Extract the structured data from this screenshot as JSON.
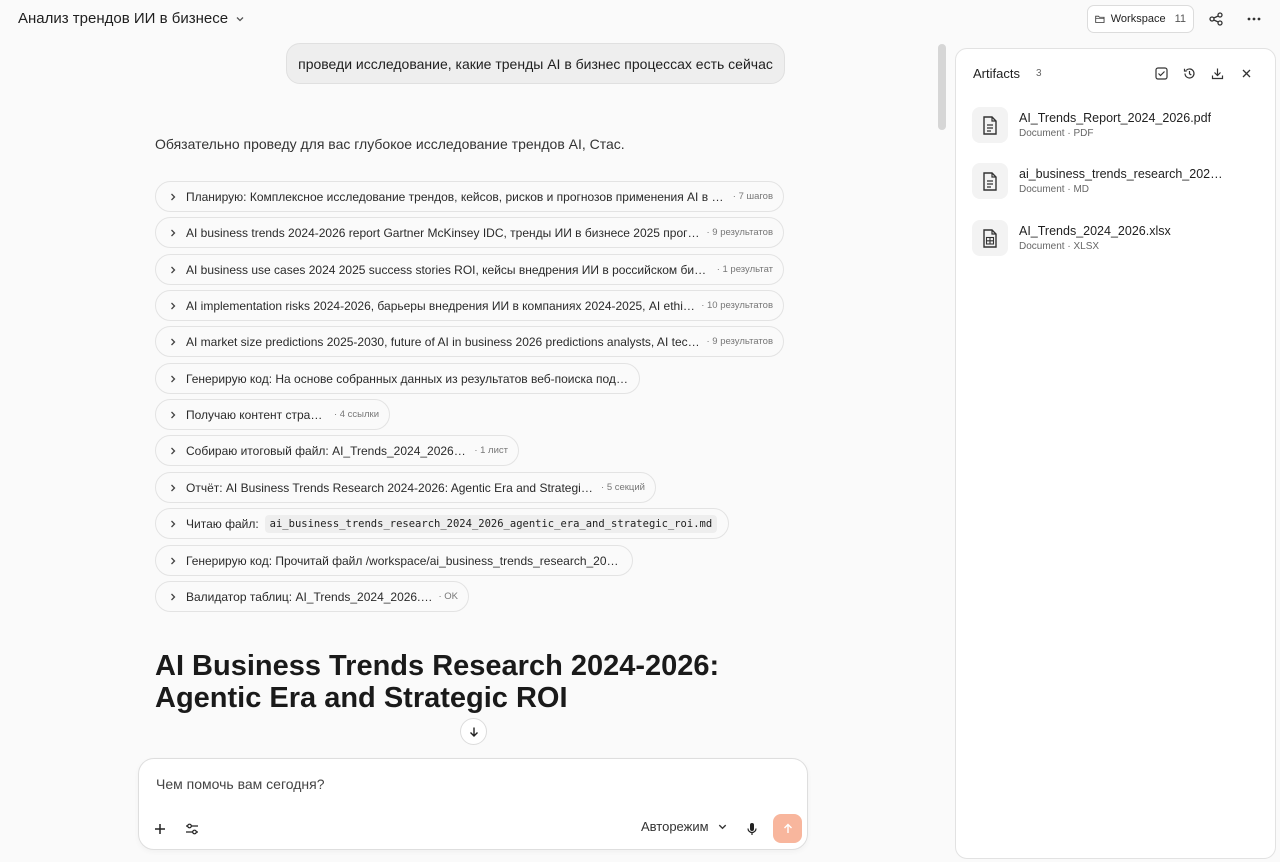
{
  "header": {
    "chat_title": "Анализ трендов ИИ в бизнесе",
    "workspace_label": "Workspace",
    "workspace_count": "11"
  },
  "chat": {
    "user_message": "проведи исследование, какие тренды AI в бизнес процессах есть сейчас",
    "assistant_intro": "Обязательно проведу для вас глубокое исследование трендов AI, Стас.",
    "steps": [
      {
        "label": "Планирую: Комплексное исследование трендов, кейсов, рисков и прогнозов применения AI в биз...",
        "meta": "· 7 шагов"
      },
      {
        "label": "AI business trends 2024-2026 report Gartner McKinsey IDC, тренды ИИ в бизнесе 2025 прогно...",
        "meta": "· 9 результатов"
      },
      {
        "label": "AI business use cases 2024 2025 success stories ROI, кейсы внедрения ИИ в российском бизнес...",
        "meta": "· 1 результат"
      },
      {
        "label": "AI implementation risks 2024-2026, барьеры внедрения ИИ в компаниях 2024-2025, AI ethic...",
        "meta": "· 10 результатов"
      },
      {
        "label": "AI market size predictions 2025-2030, future of AI in business 2026 predictions analysts, AI techn...",
        "meta": "· 9 результатов"
      },
      {
        "label": "Генерирую код: На основе собранных данных из результатов веб-поиска подгото",
        "meta": ""
      },
      {
        "label": "Получаю контент страниц",
        "meta": "· 4 ссылки"
      },
      {
        "label": "Собираю итоговый файл: AI_Trends_2024_2026.xlsx",
        "meta": "· 1 лист"
      },
      {
        "label": "Отчёт: AI Business Trends Research 2024-2026: Agentic Era and Strategic ROI",
        "meta": "· 5 секций"
      },
      {
        "label": "Читаю файл:",
        "code": "ai_business_trends_research_2024_2026_agentic_era_and_strategic_roi.md",
        "meta": ""
      },
      {
        "label": "Генерирую код: Прочитай файл /workspace/ai_business_trends_research_2024_20",
        "meta": ""
      },
      {
        "label": "Валидатор таблиц: AI_Trends_2024_2026.xlsx",
        "meta": "· OK"
      }
    ],
    "document_title": "AI Business Trends Research 2024-2026: Agentic Era and Strategic ROI"
  },
  "composer": {
    "placeholder": "Чем помочь вам сегодня?",
    "mode": "Авторежим"
  },
  "artifacts": {
    "title": "Artifacts",
    "count": "3",
    "files": [
      {
        "name": "AI_Trends_Report_2024_2026.pdf",
        "sub": "Document · PDF"
      },
      {
        "name": "ai_business_trends_research_2024_2026_agentic_era_and_strategic_roi.md",
        "sub": "Document · MD"
      },
      {
        "name": "AI_Trends_2024_2026.xlsx",
        "sub": "Document · XLSX"
      }
    ]
  },
  "colors": {
    "send_button": "#f8b69d",
    "background": "#fafafa"
  }
}
